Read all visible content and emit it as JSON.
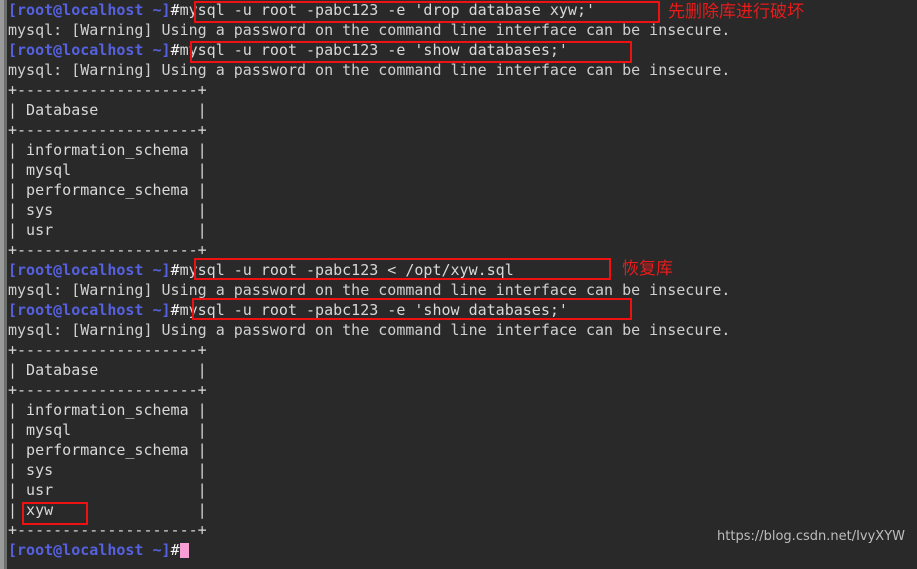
{
  "terminal": {
    "background_color": "#292929",
    "foreground_color": "#d8d8d8",
    "prompt_color": "#5561e0",
    "annotation_color": "#ee1111",
    "cursor_color": "#f79fd4",
    "prompt": "[root@localhost ~]",
    "hash": "#",
    "warning_line": "mysql: [Warning] Using a password on the command line interface can be insecure.",
    "commands": {
      "drop": "mysql -u root -pabc123 -e 'drop database xyw;'",
      "show_1": "mysql -u root -pabc123 -e 'show databases;'",
      "restore": "mysql -u root -pabc123 < /opt/xyw.sql",
      "show_2": "mysql -u root -pabc123 -e 'show databases;'"
    },
    "table": {
      "separator": "+--------------------+",
      "header": "| Database           |",
      "rows_before": [
        "| information_schema |",
        "| mysql              |",
        "| performance_schema |",
        "| sys                |",
        "| usr                |"
      ],
      "rows_after": [
        "| information_schema |",
        "| mysql              |",
        "| performance_schema |",
        "| sys                |",
        "| usr                |",
        "| xyw                |"
      ]
    },
    "annotations": {
      "drop_note": "先删除库进行破坏",
      "restore_note": "恢复库"
    },
    "watermark": "https://blog.csdn.net/IvyXYW"
  }
}
